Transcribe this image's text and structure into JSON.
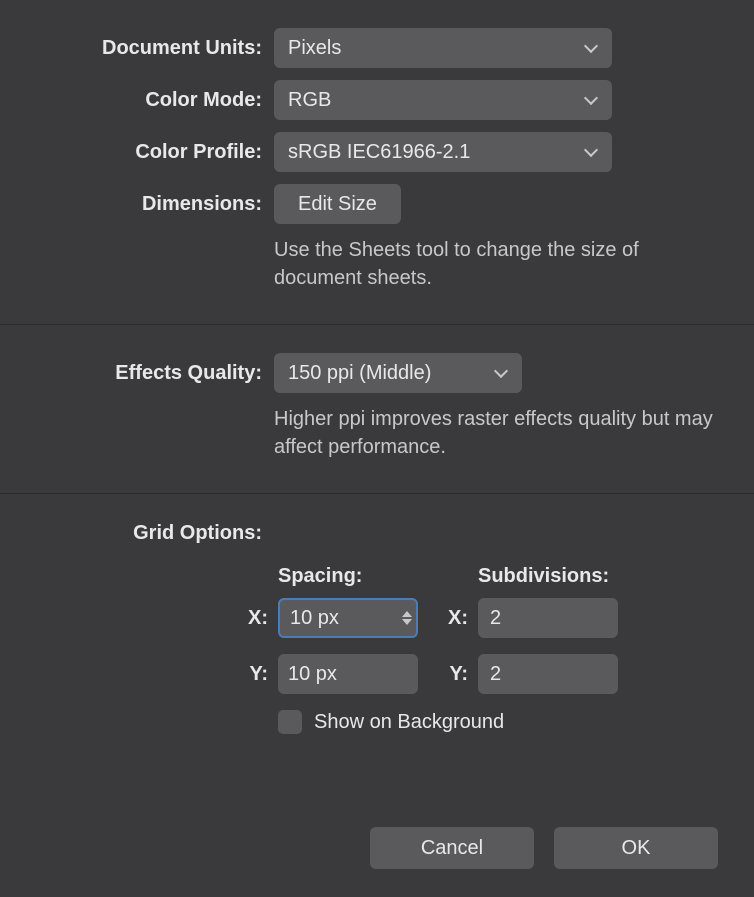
{
  "documentUnits": {
    "label": "Document Units:",
    "value": "Pixels"
  },
  "colorMode": {
    "label": "Color Mode:",
    "value": "RGB"
  },
  "colorProfile": {
    "label": "Color Profile:",
    "value": "sRGB IEC61966-2.1"
  },
  "dimensions": {
    "label": "Dimensions:",
    "button": "Edit Size",
    "helper": "Use the Sheets tool to change the size of document sheets."
  },
  "effectsQuality": {
    "label": "Effects Quality:",
    "value": "150 ppi (Middle)",
    "helper": "Higher ppi improves raster effects quality but may affect performance."
  },
  "gridOptions": {
    "label": "Grid Options:",
    "spacingHeader": "Spacing:",
    "subdivisionsHeader": "Subdivisions:",
    "xLabel": "X:",
    "yLabel": "Y:",
    "spacingX": "10 px",
    "spacingY": "10 px",
    "subX": "2",
    "subY": "2",
    "showOnBackground": "Show on Background"
  },
  "buttons": {
    "cancel": "Cancel",
    "ok": "OK"
  }
}
